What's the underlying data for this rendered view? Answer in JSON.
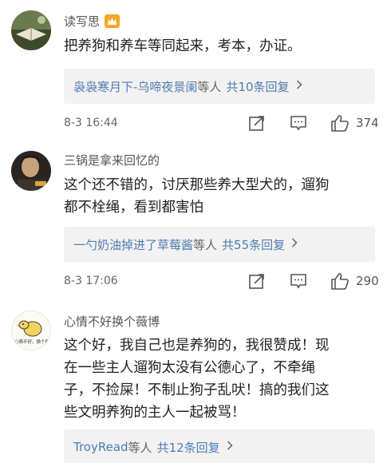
{
  "comments": [
    {
      "username": "读写思",
      "text_lines": [
        "把养狗和养车等同起来，考本，办证。"
      ],
      "reply_users": "袅袅寒月下-乌啼夜景阑",
      "reply_mid": "等人",
      "reply_count": "共10条回复",
      "time": "8-3 16:44",
      "likes": "374"
    },
    {
      "username": "三锅是拿来回忆的",
      "text_lines": [
        "这个还不错的，讨厌那些养大型犬的，遛狗",
        "都不栓绳，看到都害怕"
      ],
      "reply_users": "一勺奶油掉进了草莓酱",
      "reply_mid": "等人",
      "reply_count": "共55条回复",
      "time": "8-3 17:06",
      "likes": "290"
    },
    {
      "username": "心情不好换个薇博",
      "text_lines": [
        "这个好，我自己也是养狗的，我很赞成！现",
        "在一些主人遛狗太没有公德心了，不牵绳",
        "子，不捡屎！不制止狗子乱吠！搞的我们这",
        "些文明养狗的主人一起被骂！"
      ],
      "reply_users": "TroyRead",
      "reply_mid": "等人",
      "reply_count": "共12条回复",
      "avatar_caption": "心情不好，换个薇"
    }
  ],
  "icons": {
    "badge": "vip-badge-icon",
    "reply_arrow": "chevron-right-icon",
    "share": "share-icon",
    "comment": "comment-icon",
    "like": "thumbs-up-icon"
  },
  "colors": {
    "link": "#507daf",
    "reply_bg": "#f2f2f2",
    "badge": "#f5a623"
  }
}
